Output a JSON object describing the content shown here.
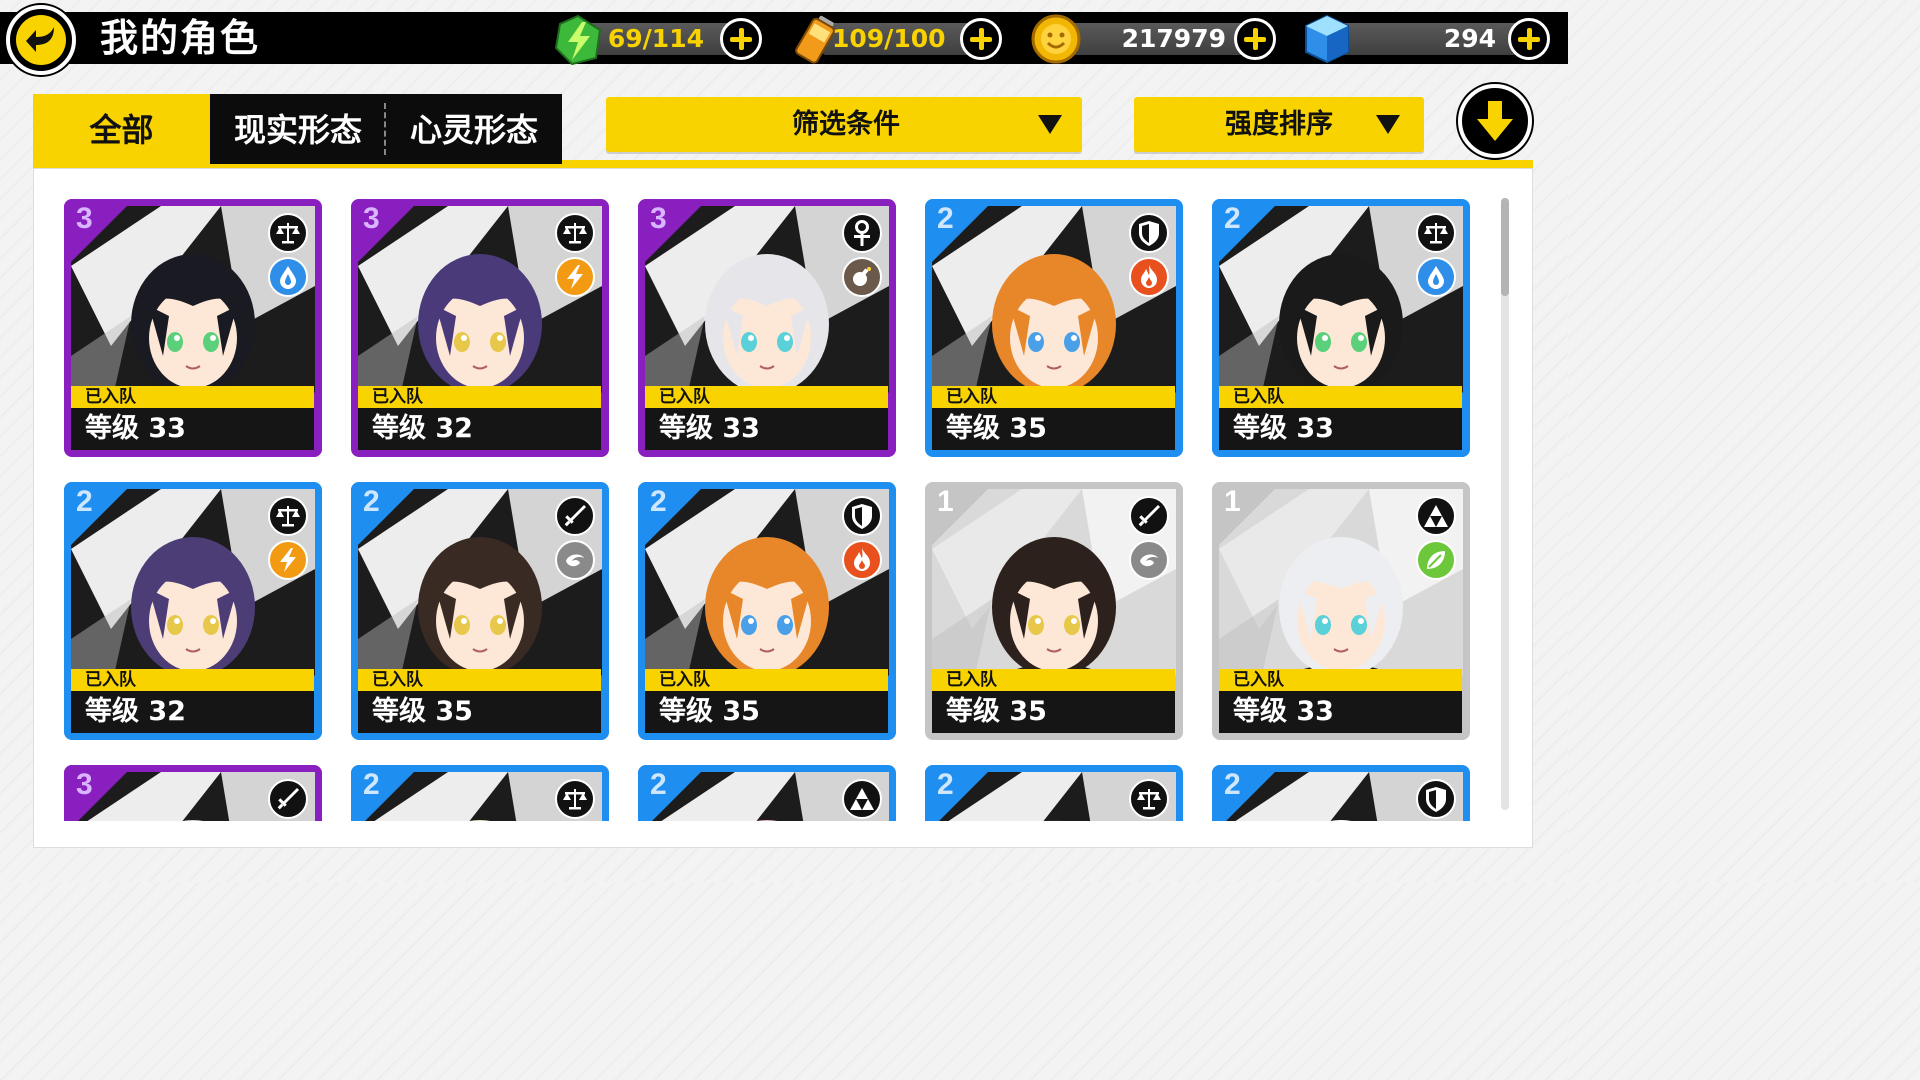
{
  "header": {
    "title": "我的角色",
    "back_icon": "back-arrow-icon",
    "resources": [
      {
        "name": "stamina",
        "icon": "lightning-gem-icon",
        "value": "69/114"
      },
      {
        "name": "battery",
        "icon": "battery-icon",
        "value": "109/100"
      },
      {
        "name": "coins",
        "icon": "coin-icon",
        "value": "217979"
      },
      {
        "name": "crystals",
        "icon": "crystal-cube-icon",
        "value": "294"
      }
    ]
  },
  "tabs": [
    {
      "label": "全部",
      "active": true
    },
    {
      "label": "现实形态",
      "active": false
    },
    {
      "label": "心灵形态",
      "active": false
    }
  ],
  "filters": {
    "filter_label": "筛选条件",
    "sort_label": "强度排序",
    "sort_direction_icon": "arrow-down-icon"
  },
  "colors": {
    "accent_yellow": "#f8d300",
    "rank3_purple": "#8a1fc0",
    "rank2_blue": "#1e8ff0",
    "rank1_gray": "#c5c5c5"
  },
  "characters": [
    {
      "rank": "3",
      "class_icon": "balance-scale-icon",
      "element_icon": "water-drop-icon",
      "status": "已入队",
      "level": "等级 33"
    },
    {
      "rank": "3",
      "class_icon": "balance-scale-icon",
      "element_icon": "lightning-icon",
      "status": "已入队",
      "level": "等级 32"
    },
    {
      "rank": "3",
      "class_icon": "ankh-icon",
      "element_icon": "bomb-icon",
      "status": "已入队",
      "level": "等级 33"
    },
    {
      "rank": "2",
      "class_icon": "shield-icon",
      "element_icon": "fire-icon",
      "status": "已入队",
      "level": "等级 35"
    },
    {
      "rank": "2",
      "class_icon": "balance-scale-icon",
      "element_icon": "water-drop-icon",
      "status": "已入队",
      "level": "等级 33"
    },
    {
      "rank": "2",
      "class_icon": "balance-scale-icon",
      "element_icon": "lightning-icon",
      "status": "已入队",
      "level": "等级 32"
    },
    {
      "rank": "2",
      "class_icon": "sword-icon",
      "element_icon": "wind-icon",
      "status": "已入队",
      "level": "等级 35"
    },
    {
      "rank": "2",
      "class_icon": "shield-icon",
      "element_icon": "fire-icon",
      "status": "已入队",
      "level": "等级 35"
    },
    {
      "rank": "1",
      "class_icon": "sword-icon",
      "element_icon": "wind-icon",
      "status": "已入队",
      "level": "等级 35"
    },
    {
      "rank": "1",
      "class_icon": "triforce-icon",
      "element_icon": "leaf-icon",
      "status": "已入队",
      "level": "等级 33"
    },
    {
      "rank": "3",
      "class_icon": "sword-icon"
    },
    {
      "rank": "2",
      "class_icon": "balance-scale-icon"
    },
    {
      "rank": "2",
      "class_icon": "triforce-icon"
    },
    {
      "rank": "2",
      "class_icon": "balance-scale-icon"
    },
    {
      "rank": "2",
      "class_icon": "shield-icon"
    }
  ]
}
